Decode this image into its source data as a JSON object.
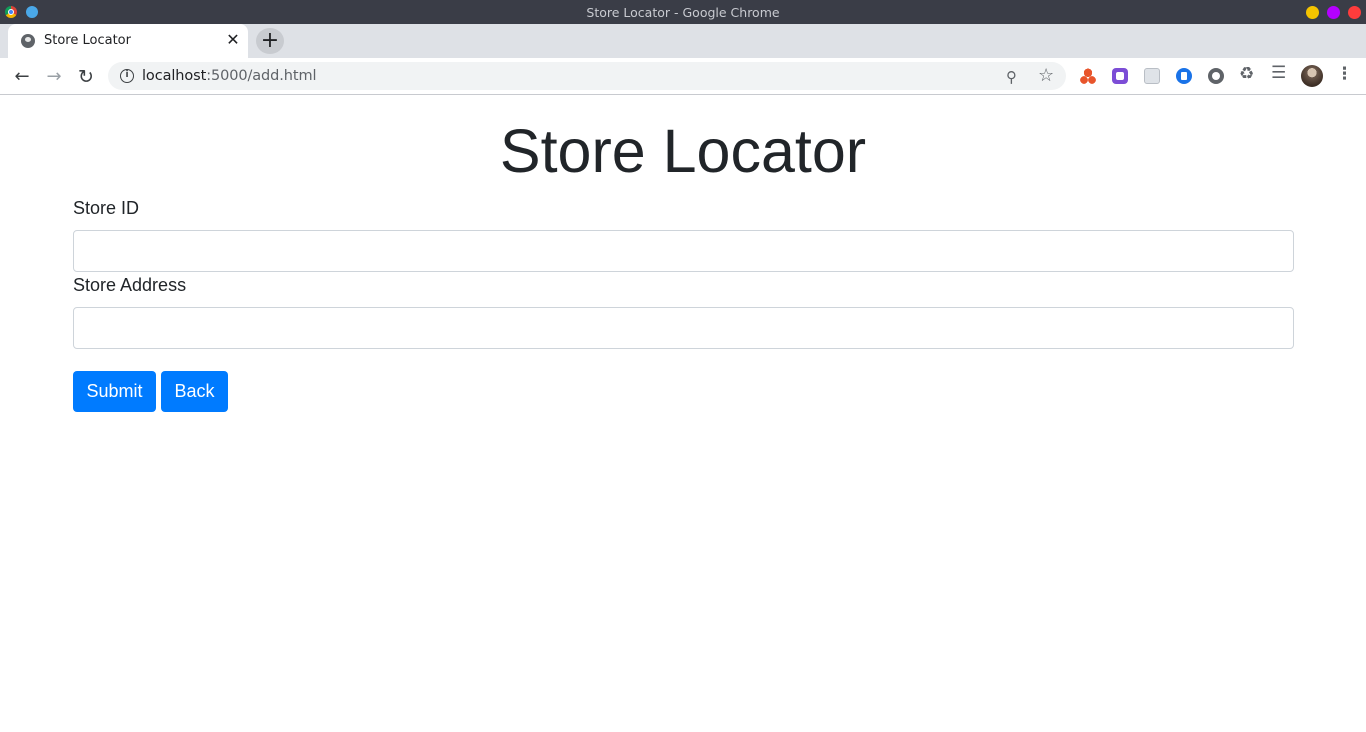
{
  "window": {
    "title": "Store Locator - Google Chrome"
  },
  "browser": {
    "tab_title": "Store Locator",
    "tab_close": "✕",
    "new_tab": "+",
    "url_host": "localhost",
    "url_path": ":5000/add.html",
    "icons": {
      "back": "back-arrow-icon",
      "forward": "forward-arrow-icon",
      "reload": "reload-icon",
      "site_info": "info-icon",
      "zoom": "zoom-icon",
      "bookmark": "star-icon",
      "extensions": "puzzle-icon",
      "media": "queue-music-icon",
      "menu": "kebab-menu-icon"
    }
  },
  "page": {
    "heading": "Store Locator",
    "form": {
      "store_id_label": "Store ID",
      "store_id_value": "",
      "store_address_label": "Store Address",
      "store_address_value": "",
      "submit_label": "Submit",
      "back_label": "Back"
    }
  },
  "colors": {
    "primary_button": "#007bff",
    "text": "#212529",
    "input_border": "#ced4da"
  }
}
